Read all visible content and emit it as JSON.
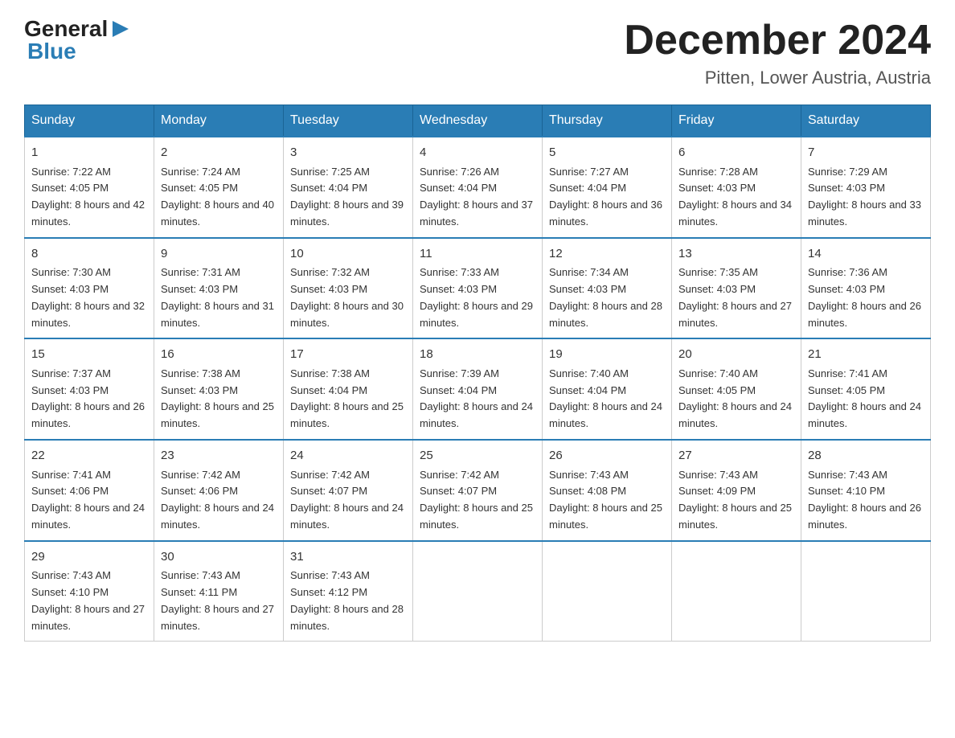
{
  "header": {
    "logo_general": "General",
    "logo_blue": "Blue",
    "title": "December 2024",
    "location": "Pitten, Lower Austria, Austria"
  },
  "days_of_week": [
    "Sunday",
    "Monday",
    "Tuesday",
    "Wednesday",
    "Thursday",
    "Friday",
    "Saturday"
  ],
  "weeks": [
    [
      {
        "day": "1",
        "sunrise": "7:22 AM",
        "sunset": "4:05 PM",
        "daylight": "8 hours and 42 minutes."
      },
      {
        "day": "2",
        "sunrise": "7:24 AM",
        "sunset": "4:05 PM",
        "daylight": "8 hours and 40 minutes."
      },
      {
        "day": "3",
        "sunrise": "7:25 AM",
        "sunset": "4:04 PM",
        "daylight": "8 hours and 39 minutes."
      },
      {
        "day": "4",
        "sunrise": "7:26 AM",
        "sunset": "4:04 PM",
        "daylight": "8 hours and 37 minutes."
      },
      {
        "day": "5",
        "sunrise": "7:27 AM",
        "sunset": "4:04 PM",
        "daylight": "8 hours and 36 minutes."
      },
      {
        "day": "6",
        "sunrise": "7:28 AM",
        "sunset": "4:03 PM",
        "daylight": "8 hours and 34 minutes."
      },
      {
        "day": "7",
        "sunrise": "7:29 AM",
        "sunset": "4:03 PM",
        "daylight": "8 hours and 33 minutes."
      }
    ],
    [
      {
        "day": "8",
        "sunrise": "7:30 AM",
        "sunset": "4:03 PM",
        "daylight": "8 hours and 32 minutes."
      },
      {
        "day": "9",
        "sunrise": "7:31 AM",
        "sunset": "4:03 PM",
        "daylight": "8 hours and 31 minutes."
      },
      {
        "day": "10",
        "sunrise": "7:32 AM",
        "sunset": "4:03 PM",
        "daylight": "8 hours and 30 minutes."
      },
      {
        "day": "11",
        "sunrise": "7:33 AM",
        "sunset": "4:03 PM",
        "daylight": "8 hours and 29 minutes."
      },
      {
        "day": "12",
        "sunrise": "7:34 AM",
        "sunset": "4:03 PM",
        "daylight": "8 hours and 28 minutes."
      },
      {
        "day": "13",
        "sunrise": "7:35 AM",
        "sunset": "4:03 PM",
        "daylight": "8 hours and 27 minutes."
      },
      {
        "day": "14",
        "sunrise": "7:36 AM",
        "sunset": "4:03 PM",
        "daylight": "8 hours and 26 minutes."
      }
    ],
    [
      {
        "day": "15",
        "sunrise": "7:37 AM",
        "sunset": "4:03 PM",
        "daylight": "8 hours and 26 minutes."
      },
      {
        "day": "16",
        "sunrise": "7:38 AM",
        "sunset": "4:03 PM",
        "daylight": "8 hours and 25 minutes."
      },
      {
        "day": "17",
        "sunrise": "7:38 AM",
        "sunset": "4:04 PM",
        "daylight": "8 hours and 25 minutes."
      },
      {
        "day": "18",
        "sunrise": "7:39 AM",
        "sunset": "4:04 PM",
        "daylight": "8 hours and 24 minutes."
      },
      {
        "day": "19",
        "sunrise": "7:40 AM",
        "sunset": "4:04 PM",
        "daylight": "8 hours and 24 minutes."
      },
      {
        "day": "20",
        "sunrise": "7:40 AM",
        "sunset": "4:05 PM",
        "daylight": "8 hours and 24 minutes."
      },
      {
        "day": "21",
        "sunrise": "7:41 AM",
        "sunset": "4:05 PM",
        "daylight": "8 hours and 24 minutes."
      }
    ],
    [
      {
        "day": "22",
        "sunrise": "7:41 AM",
        "sunset": "4:06 PM",
        "daylight": "8 hours and 24 minutes."
      },
      {
        "day": "23",
        "sunrise": "7:42 AM",
        "sunset": "4:06 PM",
        "daylight": "8 hours and 24 minutes."
      },
      {
        "day": "24",
        "sunrise": "7:42 AM",
        "sunset": "4:07 PM",
        "daylight": "8 hours and 24 minutes."
      },
      {
        "day": "25",
        "sunrise": "7:42 AM",
        "sunset": "4:07 PM",
        "daylight": "8 hours and 25 minutes."
      },
      {
        "day": "26",
        "sunrise": "7:43 AM",
        "sunset": "4:08 PM",
        "daylight": "8 hours and 25 minutes."
      },
      {
        "day": "27",
        "sunrise": "7:43 AM",
        "sunset": "4:09 PM",
        "daylight": "8 hours and 25 minutes."
      },
      {
        "day": "28",
        "sunrise": "7:43 AM",
        "sunset": "4:10 PM",
        "daylight": "8 hours and 26 minutes."
      }
    ],
    [
      {
        "day": "29",
        "sunrise": "7:43 AM",
        "sunset": "4:10 PM",
        "daylight": "8 hours and 27 minutes."
      },
      {
        "day": "30",
        "sunrise": "7:43 AM",
        "sunset": "4:11 PM",
        "daylight": "8 hours and 27 minutes."
      },
      {
        "day": "31",
        "sunrise": "7:43 AM",
        "sunset": "4:12 PM",
        "daylight": "8 hours and 28 minutes."
      },
      null,
      null,
      null,
      null
    ]
  ],
  "labels": {
    "sunrise_prefix": "Sunrise: ",
    "sunset_prefix": "Sunset: ",
    "daylight_prefix": "Daylight: "
  }
}
